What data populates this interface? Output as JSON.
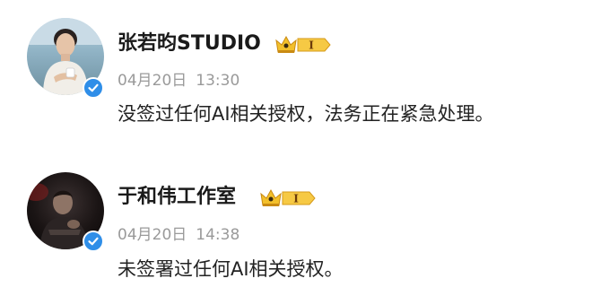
{
  "posts": [
    {
      "name": "张若昀STUDIO",
      "vip_level": "I",
      "date": "04月20日",
      "time": "13:30",
      "text": "没签过任何AI相关授权，法务正在紧急处理。",
      "avatar_icon": "user-avatar-photo",
      "verified_icon": "verified-check-icon"
    },
    {
      "name": "于和伟工作室",
      "vip_level": "I",
      "date": "04月20日",
      "time": "14:38",
      "text": "未签署过任何AI相关授权。",
      "avatar_icon": "user-avatar-photo",
      "verified_icon": "verified-check-icon"
    }
  ],
  "colors": {
    "verified_badge": "#2f8ee8",
    "vip_gold": "#f3c02b",
    "meta_text": "#9a9a9a",
    "name_text": "#1a1a1a"
  }
}
